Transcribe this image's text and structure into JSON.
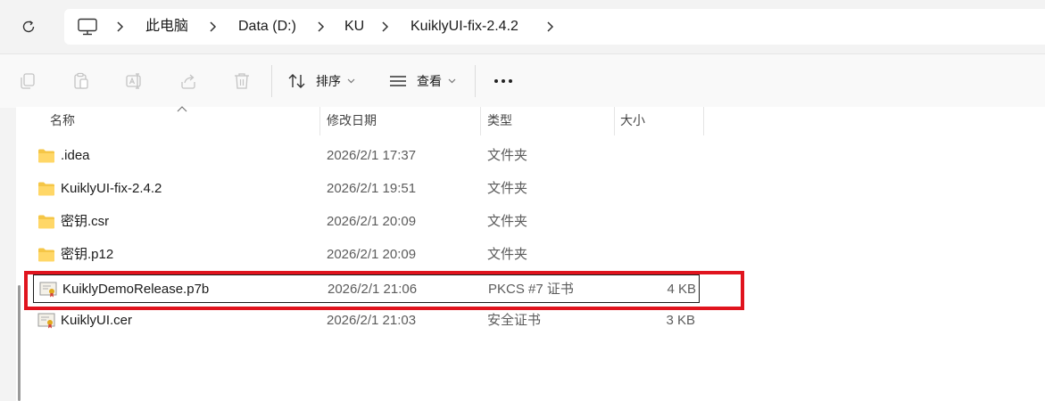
{
  "breadcrumb": {
    "items": [
      "此电脑",
      "Data (D:)",
      "KU",
      "KuiklyUI-fix-2.4.2"
    ]
  },
  "toolbar": {
    "sort_label": "排序",
    "view_label": "查看"
  },
  "columns": {
    "name": "名称",
    "modified": "修改日期",
    "type": "类型",
    "size": "大小"
  },
  "files": [
    {
      "name": ".idea",
      "modified": "2026/2/1 17:37",
      "type": "文件夹",
      "size": "",
      "icon": "folder-icon"
    },
    {
      "name": "KuiklyUI-fix-2.4.2",
      "modified": "2026/2/1 19:51",
      "type": "文件夹",
      "size": "",
      "icon": "folder-icon"
    },
    {
      "name": "密钥.csr",
      "modified": "2026/2/1 20:09",
      "type": "文件夹",
      "size": "",
      "icon": "folder-icon"
    },
    {
      "name": "密钥.p12",
      "modified": "2026/2/1 20:09",
      "type": "文件夹",
      "size": "",
      "icon": "folder-icon"
    },
    {
      "name": "KuiklyDemoRelease.p7b",
      "modified": "2026/2/1 21:06",
      "type": "PKCS #7 证书",
      "size": "4 KB",
      "icon": "certificate-icon"
    },
    {
      "name": "KuiklyUI.cer",
      "modified": "2026/2/1 21:03",
      "type": "安全证书",
      "size": "3 KB",
      "icon": "certificate-icon"
    }
  ],
  "colors": {
    "highlight_box": "#e0141e",
    "folder": "#f5c646"
  }
}
